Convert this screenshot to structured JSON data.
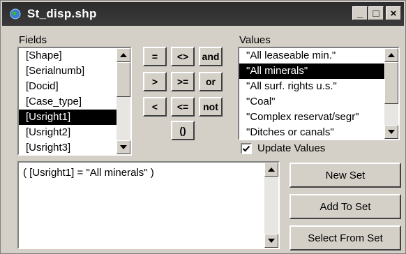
{
  "window": {
    "title": "St_disp.shp",
    "icon": "globe-app-icon",
    "controls": {
      "minimize": "_",
      "maximize": "□",
      "close": "×"
    }
  },
  "fields": {
    "label": "Fields",
    "items": [
      "[Shape]",
      "[Serialnumb]",
      "[Docid]",
      "[Case_type]",
      "[Usright1]",
      "[Usright2]",
      "[Usright3]"
    ],
    "selected_index": 4
  },
  "operators": [
    "=",
    "<>",
    "and",
    ">",
    ">=",
    "or",
    "<",
    "<=",
    "not",
    "()"
  ],
  "values": {
    "label": "Values",
    "items": [
      "\"All leaseable min.\"",
      "\"All minerals\"",
      "\"All surf. rights u.s.\"",
      "\"Coal\"",
      "\"Complex reservat/segr\"",
      "\"Ditches or canals\""
    ],
    "selected_index": 1
  },
  "update_values": {
    "label": "Update Values",
    "checked": true
  },
  "expression": {
    "text": "( [Usright1] = \"All minerals\" )"
  },
  "buttons": {
    "new_set": "New Set",
    "add_to_set": "Add To Set",
    "select_from_set": "Select From Set"
  }
}
